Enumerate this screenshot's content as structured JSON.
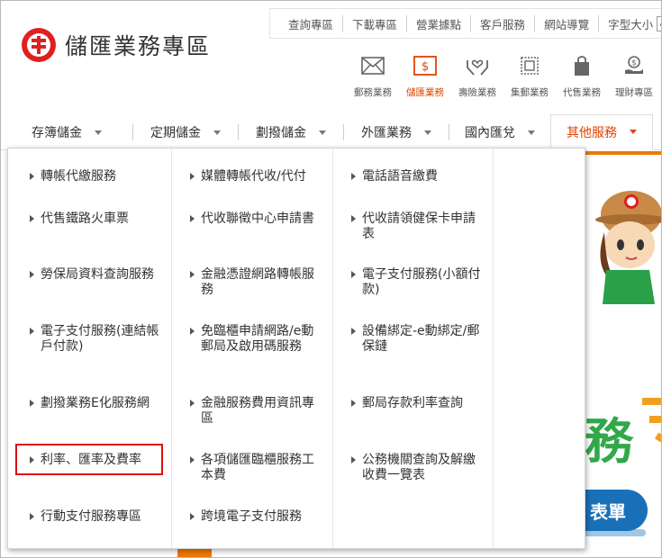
{
  "header": {
    "logo_text": "儲匯業務專區",
    "top_links": [
      "查詢專區",
      "下載專區",
      "營業據點",
      "客戶服務",
      "網站導覽"
    ],
    "font_size_label": "字型大小",
    "font_size_value": "小"
  },
  "services": [
    {
      "label": "郵務業務",
      "icon": "envelope-icon"
    },
    {
      "label": "儲匯業務",
      "icon": "dollar-icon",
      "active": true
    },
    {
      "label": "壽險業務",
      "icon": "hands-heart-icon"
    },
    {
      "label": "集郵業務",
      "icon": "stamp-icon"
    },
    {
      "label": "代售業務",
      "icon": "shopping-bag-icon"
    },
    {
      "label": "理財專區",
      "icon": "money-hand-icon"
    }
  ],
  "nav": {
    "items": [
      "存簿儲金",
      "定期儲金",
      "劃撥儲金",
      "外匯業務",
      "國內匯兌",
      "其他服務"
    ],
    "active": "其他服務"
  },
  "dropdown": {
    "columns": [
      [
        "轉帳代繳服務",
        "代售鐵路火車票",
        "勞保局資料查詢服務",
        "電子支付服務(連結帳戶付款)",
        "劃撥業務E化服務網",
        "利率、匯率及費率",
        "行動支付服務專區"
      ],
      [
        "媒體轉帳代收/代付",
        "代收聯徵中心申請書",
        "金融憑證網路轉帳服務",
        "免臨櫃申請網路/e動郵局及啟用碼服務",
        "金融服務費用資訊專區",
        "各項儲匯臨櫃服務工本費",
        "跨境電子支付服務"
      ],
      [
        "電話語音繳費",
        "代收請領健保卡申請表",
        "電子支付服務(小額付款)",
        "設備綁定-e動綁定/郵保鏈",
        "郵局存款利率查詢",
        "公務機關查詢及解繳收費一覽表"
      ]
    ],
    "highlighted": "利率、匯率及費率"
  },
  "banner": {
    "char1": "務",
    "pill_text": "表單"
  },
  "colors": {
    "accent": "#e04300",
    "logo_red": "#e02020",
    "highlight_border": "#e01010",
    "banner_green": "#32a84a",
    "banner_blue": "#1a70b8"
  }
}
